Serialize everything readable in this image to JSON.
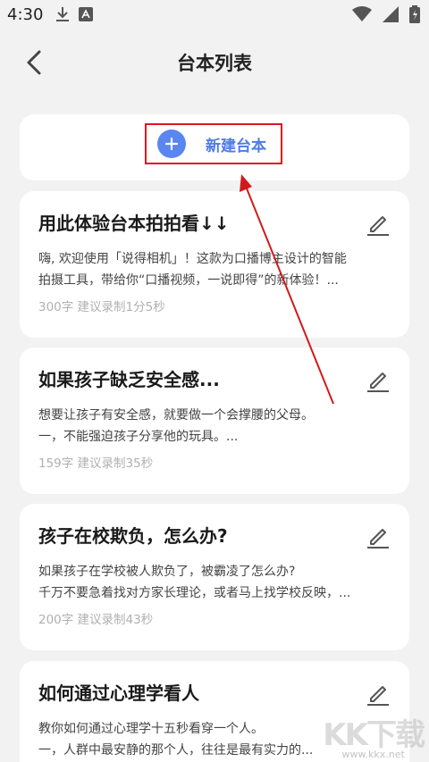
{
  "status_bar": {
    "time": "4:30"
  },
  "header": {
    "title": "台本列表"
  },
  "new_script": {
    "label": "新建台本"
  },
  "scripts": [
    {
      "title": "用此体验台本拍拍看↓↓",
      "desc_line1": "嗨, 欢迎使用「说得相机」！这款为口播博主设计的智能",
      "desc_line2": "拍摄工具，带给你“口播视频，一说即得”的新体验！...",
      "meta": "300字  建议录制1分5秒"
    },
    {
      "title": "如果孩子缺乏安全感...",
      "desc_line1": "想要让孩子有安全感，就要做一个会撑腰的父母。",
      "desc_line2": "一，不能强迫孩子分享他的玩具。...",
      "meta": "159字  建议录制35秒"
    },
    {
      "title": "孩子在校欺负，怎么办?",
      "desc_line1": "如果孩子在学校被人欺负了，被霸凌了怎么办?",
      "desc_line2": "千万不要急着找对方家长理论，或者马上找学校反映，...",
      "meta": "200字  建议录制43秒"
    },
    {
      "title": "如何通过心理学看人",
      "desc_line1": "教你如何通过心理学十五秒看穿一个人。",
      "desc_line2": "一，人群中最安静的那个人，往往是最有实力的...",
      "meta": ""
    }
  ],
  "watermark": {
    "text": "KK下载",
    "url": "www.kkx.net"
  },
  "colors": {
    "accent": "#4e7ae8",
    "highlight": "#e0141e",
    "background": "#f2f2f2"
  }
}
